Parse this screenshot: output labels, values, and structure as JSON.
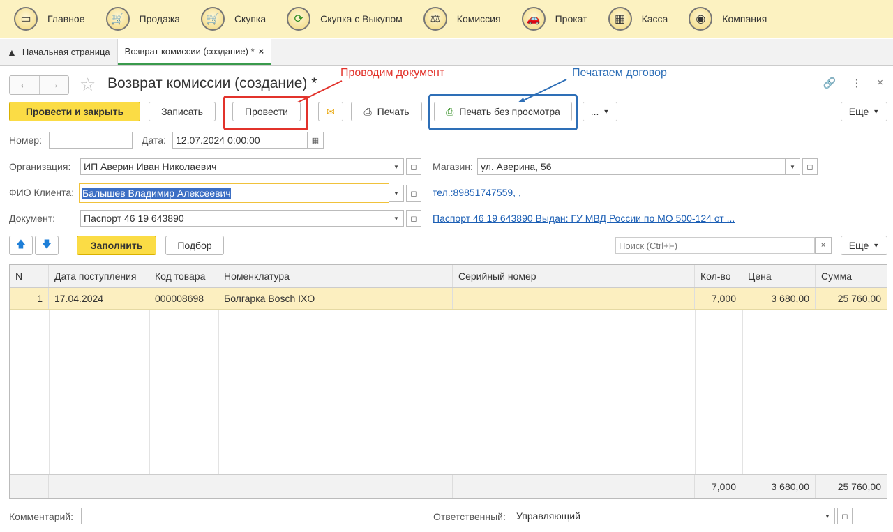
{
  "sections": [
    {
      "label": "Главное",
      "icon": "desktop-icon",
      "glyph": "▭"
    },
    {
      "label": "Продажа",
      "icon": "cart-icon",
      "glyph": "🛒"
    },
    {
      "label": "Скупка",
      "icon": "basket-icon",
      "glyph": "🛒"
    },
    {
      "label": "Скупка с Выкупом",
      "icon": "refresh-icon",
      "glyph": "⟳"
    },
    {
      "label": "Комиссия",
      "icon": "scales-icon",
      "glyph": "⚖"
    },
    {
      "label": "Прокат",
      "icon": "rent-icon",
      "glyph": "🚗"
    },
    {
      "label": "Касса",
      "icon": "cash-register-icon",
      "glyph": "▦"
    },
    {
      "label": "Компания",
      "icon": "company-icon",
      "glyph": "◉"
    }
  ],
  "tabs": {
    "home": "Начальная страница",
    "current": "Возврат комиссии (создание) *"
  },
  "title": "Возврат комиссии (создание) *",
  "toolbar": {
    "post_close": "Провести и закрыть",
    "write": "Записать",
    "post": "Провести",
    "print": "Печать",
    "print_no_preview": "Печать без просмотра",
    "more_dots": "...",
    "more": "Еще"
  },
  "annotations": {
    "post": "Проводим документ",
    "print": "Печатаем договор"
  },
  "form": {
    "number_label": "Номер:",
    "number_value": "",
    "date_label": "Дата:",
    "date_value": "12.07.2024  0:00:00",
    "org_label": "Организация:",
    "org_value": "ИП Аверин Иван Николаевич",
    "shop_label": "Магазин:",
    "shop_value": "ул. Аверина, 56",
    "client_label": "ФИО Клиента:",
    "client_value": "Балышев Владимир Алексеевич",
    "phone_link": "тел.:89851747559, ,",
    "doc_label": "Документ:",
    "doc_value": "Паспорт 46 19 643890",
    "doc_link": "Паспорт 46 19 643890 Выдан: ГУ МВД России по МО 500-124 от ..."
  },
  "table_toolbar": {
    "fill": "Заполнить",
    "select": "Подбор",
    "search_placeholder": "Поиск (Ctrl+F)",
    "more": "Еще"
  },
  "table": {
    "headers": [
      "N",
      "Дата поступления",
      "Код товара",
      "Номенклатура",
      "Серийный номер",
      "Кол-во",
      "Цена",
      "Сумма"
    ],
    "rows": [
      [
        "1",
        "17.04.2024",
        "000008698",
        "Болгарка Bosch IXO",
        "",
        "7,000",
        "3 680,00",
        "25 760,00"
      ]
    ],
    "totals": {
      "qty": "7,000",
      "price": "3 680,00",
      "sum": "25 760,00"
    }
  },
  "footer": {
    "comment_label": "Комментарий:",
    "comment_value": "",
    "responsible_label": "Ответственный:",
    "responsible_value": "Управляющий"
  },
  "colors": {
    "accent_yellow": "#fbdc45",
    "annot_red": "#e2322b",
    "annot_blue": "#2e6fb7",
    "link": "#1c5fb5"
  }
}
